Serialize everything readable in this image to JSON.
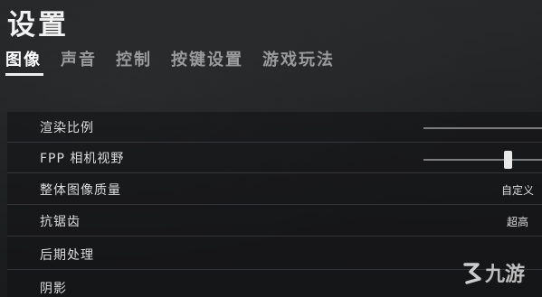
{
  "header": {
    "title": "设置"
  },
  "tabs": [
    {
      "label": "图像",
      "active": true
    },
    {
      "label": "声音",
      "active": false
    },
    {
      "label": "控制",
      "active": false
    },
    {
      "label": "按键设置",
      "active": false
    },
    {
      "label": "游戏玩法",
      "active": false
    }
  ],
  "settings": [
    {
      "label": "渲染比例",
      "control": "slider"
    },
    {
      "label": "FPP 相机视野",
      "control": "slider"
    },
    {
      "label": "整体图像质量",
      "control": "select",
      "value": "自定义"
    },
    {
      "label": "抗锯齿",
      "control": "select",
      "value": "超高"
    },
    {
      "label": "后期处理",
      "control": "select"
    },
    {
      "label": "阴影",
      "control": "select"
    }
  ],
  "watermark": {
    "text": "九游"
  }
}
